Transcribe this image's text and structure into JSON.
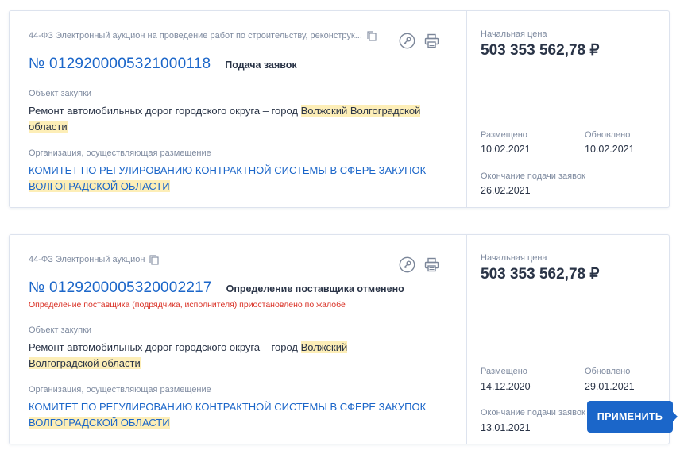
{
  "cards": [
    {
      "type_line": "44-ФЗ Электронный аукцион на проведение работ по строительству, реконструк...",
      "number": "№ 0129200005321000118",
      "status": "Подача заявок",
      "object_label": "Объект закупки",
      "object_text_plain": "Ремонт автомобильных дорог городского округа – город ",
      "object_text_highlight_1": "Волжский Волгоградской",
      "object_text_highlight_2": "области",
      "org_label": "Организация, осуществляющая размещение",
      "org_line_1": "КОМИТЕТ ПО РЕГУЛИРОВАНИЮ КОНТРАКТНОЙ СИСТЕМЫ В СФЕРЕ ЗАКУПОК",
      "org_line_2": "ВОЛГОГРАДСКОЙ ОБЛАСТИ",
      "price_label": "Начальная цена",
      "price": "503 353 562,78 ₽",
      "posted_label": "Размещено",
      "posted": "10.02.2021",
      "updated_label": "Обновлено",
      "updated": "10.02.2021",
      "deadline_label": "Окончание подачи заявок",
      "deadline": "26.02.2021"
    },
    {
      "type_line": "44-ФЗ Электронный аукцион",
      "number": "№ 0129200005320002217",
      "status": "Определение поставщика отменено",
      "warning": "Определение поставщика (подрядчика, исполнителя) приостановлено по жалобе",
      "object_label": "Объект закупки",
      "object_text_plain": " Ремонт  автомобильных дорог городского округа – город ",
      "object_text_highlight_1": "Волжский",
      "object_text_highlight_2": "Волгоградской области",
      "org_label": "Организация, осуществляющая размещение",
      "org_line_1": "КОМИТЕТ ПО РЕГУЛИРОВАНИЮ КОНТРАКТНОЙ СИСТЕМЫ В СФЕРЕ ЗАКУПОК",
      "org_line_2": "ВОЛГОГРАДСКОЙ ОБЛАСТИ",
      "price_label": "Начальная цена",
      "price": "503 353 562,78 ₽",
      "posted_label": "Размещено",
      "posted": "14.12.2020",
      "updated_label": "Обновлено",
      "updated": "29.01.2021",
      "deadline_label": "Окончание подачи заявок",
      "deadline": "13.01.2021"
    }
  ],
  "apply_button": "ПРИМЕНИТЬ",
  "colors": {
    "link": "#1b66c9",
    "highlight": "#fdeeb7",
    "warning": "#d93025"
  },
  "icons": [
    "copy-icon",
    "key-icon",
    "printer-icon"
  ]
}
